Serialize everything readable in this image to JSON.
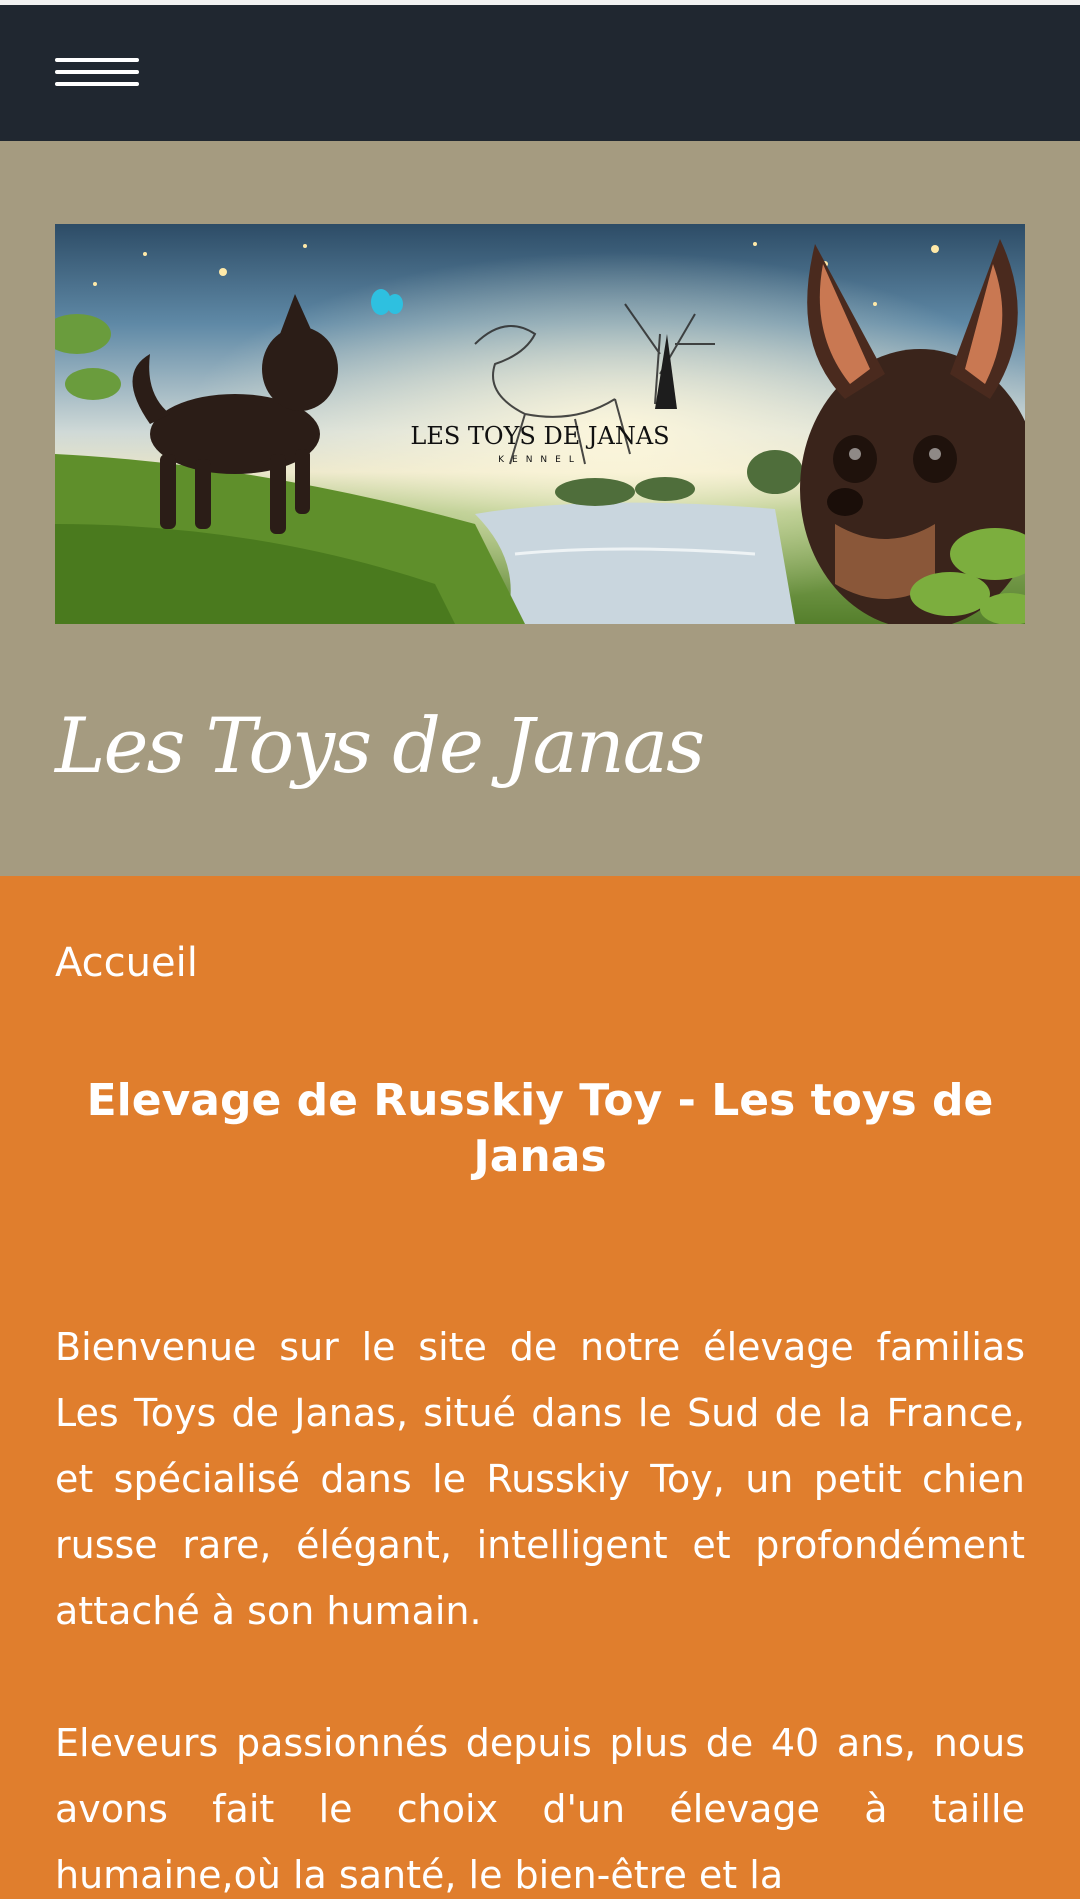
{
  "nav": {
    "menu_icon": "hamburger-icon"
  },
  "banner": {
    "logo_title": "LES TOYS DE JANAS",
    "logo_subtitle": "KENNEL"
  },
  "site": {
    "title": "Les Toys de Janas"
  },
  "breadcrumb": "Accueil",
  "main": {
    "heading": "Elevage de Russkiy Toy - Les toys de Janas",
    "paragraphs": [
      "Bienvenue  sur le site de notre élevage familias Les Toys de Janas, situé dans le Sud de la France, et spécialisé dans le Russkiy Toy, un petit chien russe rare, élégant, intelligent et profondément attaché à son humain.",
      "Eleveurs passionnés depuis plus de 40 ans, nous avons fait le choix d'un élevage à taille humaine,où la santé, le bien-être et la"
    ]
  },
  "colors": {
    "navbar": "#202730",
    "header_band": "#a59b80",
    "content_bg": "#e07e2d",
    "text": "#ffffff"
  }
}
